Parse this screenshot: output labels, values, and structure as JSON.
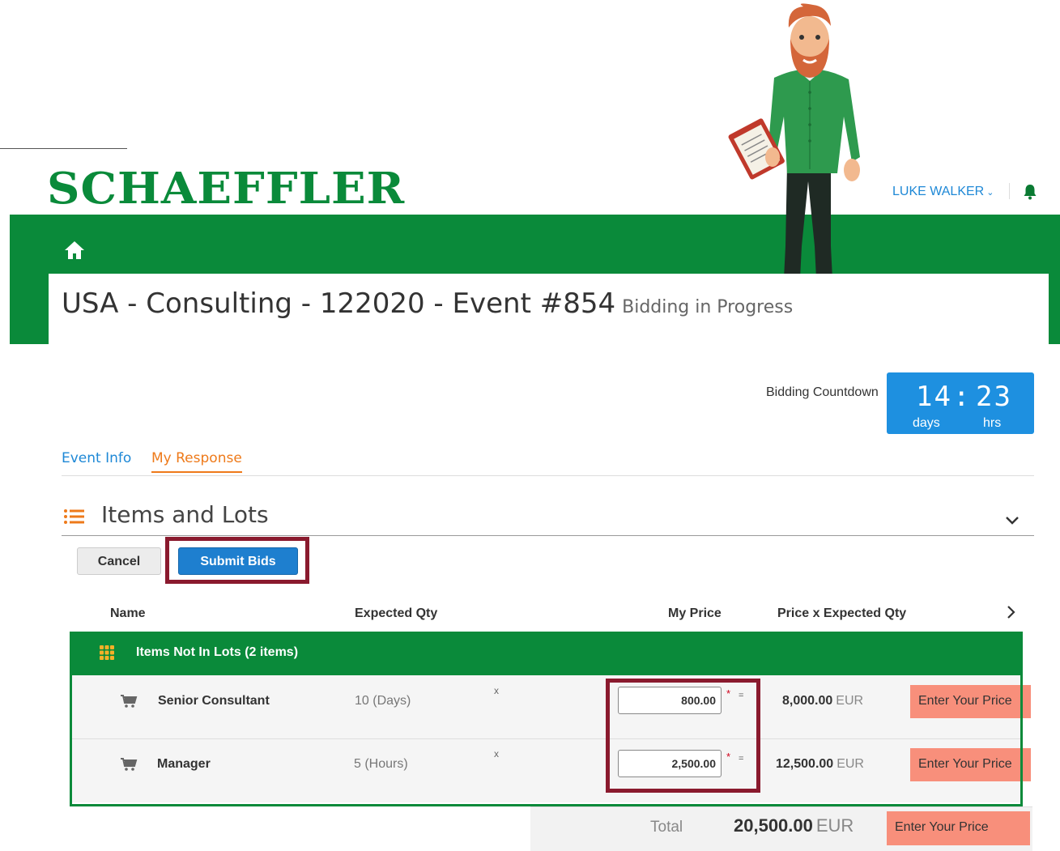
{
  "header": {
    "brand": "SCHAEFFLER",
    "user_name": "LUKE WALKER",
    "user_menu_icon": "chevron-down-icon",
    "notifications_icon": "bell-icon",
    "home_icon": "home-icon",
    "brand_color": "#0a8a3a"
  },
  "event": {
    "title": "USA - Consulting - 122020 - Event #854",
    "status": "Bidding in Progress"
  },
  "countdown": {
    "label": "Bidding Countdown",
    "days": "14",
    "separator": ":",
    "hours": "23",
    "days_unit": "days",
    "hours_unit": "hrs"
  },
  "tabs": [
    {
      "label": "Event Info",
      "active": false
    },
    {
      "label": "My Response",
      "active": true
    }
  ],
  "section": {
    "title": "Items and Lots",
    "icon": "list-icon",
    "collapse_icon": "chevron-down-icon"
  },
  "actions": {
    "cancel": "Cancel",
    "submit": "Submit Bids"
  },
  "columns": {
    "name": "Name",
    "expected_qty": "Expected Qty",
    "my_price": "My Price",
    "price_x_qty": "Price x Expected Qty"
  },
  "group": {
    "label": "Items Not In Lots (2 items)",
    "icon": "grid-icon"
  },
  "items": [
    {
      "name": "Senior Consultant",
      "qty": "10 (Days)",
      "times": "x",
      "price": "800.00",
      "required": "*",
      "equals": "=",
      "extended": "8,000.00",
      "currency": "EUR",
      "action": "Enter Your Price",
      "icon": "cart-icon"
    },
    {
      "name": "Manager",
      "qty": "5 (Hours)",
      "times": "x",
      "price": "2,500.00",
      "required": "*",
      "equals": "=",
      "extended": "12,500.00",
      "currency": "EUR",
      "action": "Enter Your Price",
      "icon": "cart-icon"
    }
  ],
  "total": {
    "label": "Total",
    "value": "20,500.00",
    "currency": "EUR",
    "action": "Enter Your Price"
  }
}
